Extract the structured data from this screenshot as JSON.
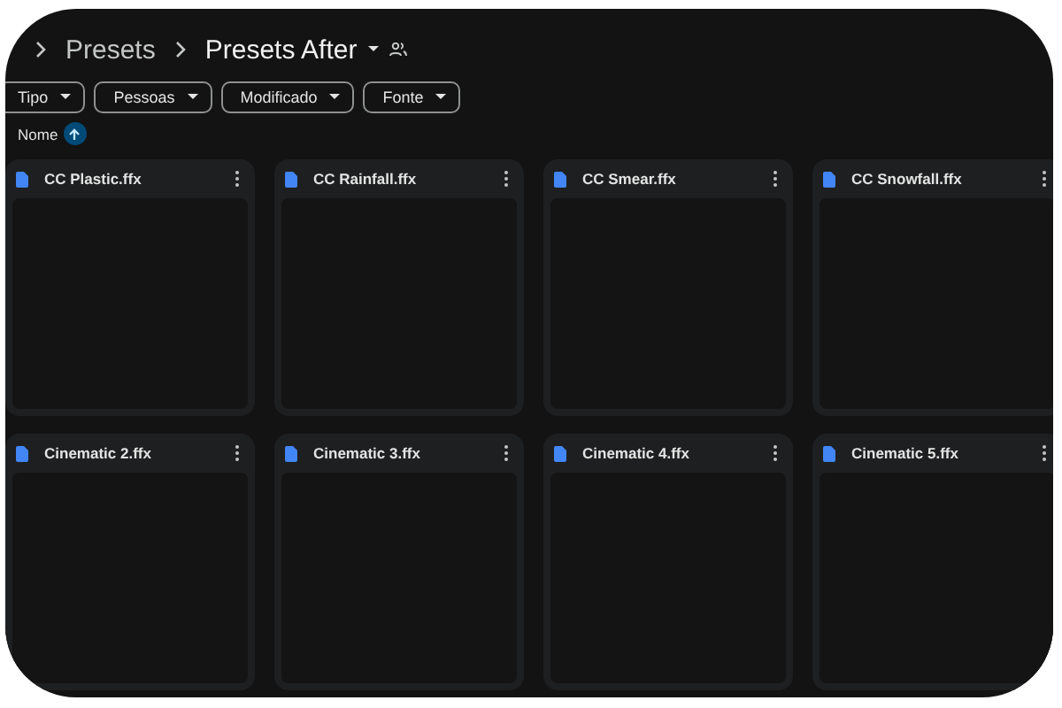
{
  "breadcrumb": [
    {
      "label": "Presets",
      "current": false
    },
    {
      "label": "Presets After",
      "current": true
    }
  ],
  "filters": [
    "Tipo",
    "Pessoas",
    "Modificado",
    "Fonte"
  ],
  "sort": {
    "label": "Nome"
  },
  "files": [
    {
      "name": "CC Plastic.ffx"
    },
    {
      "name": "CC Rainfall.ffx"
    },
    {
      "name": "CC Smear.ffx"
    },
    {
      "name": "CC Snowfall.ffx"
    },
    {
      "name": "Cinematic 2.ffx"
    },
    {
      "name": "Cinematic 3.ffx"
    },
    {
      "name": "Cinematic 4.ffx"
    },
    {
      "name": "Cinematic 5.ffx"
    }
  ]
}
